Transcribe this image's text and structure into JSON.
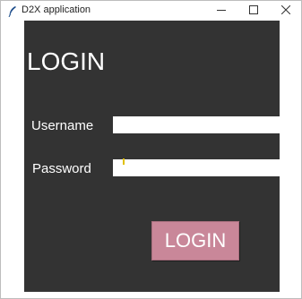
{
  "window": {
    "title": "D2X application",
    "icon": "feather-icon",
    "controls": [
      "minimize-icon",
      "maximize-icon",
      "close-icon"
    ]
  },
  "login_form": {
    "heading": "LOGIN",
    "username_label": "Username",
    "username_value": "",
    "password_label": "Password",
    "password_value": "",
    "submit_label": "LOGIN"
  },
  "colors": {
    "background": "#333333",
    "button": "#c98799",
    "text": "#ffffff"
  }
}
